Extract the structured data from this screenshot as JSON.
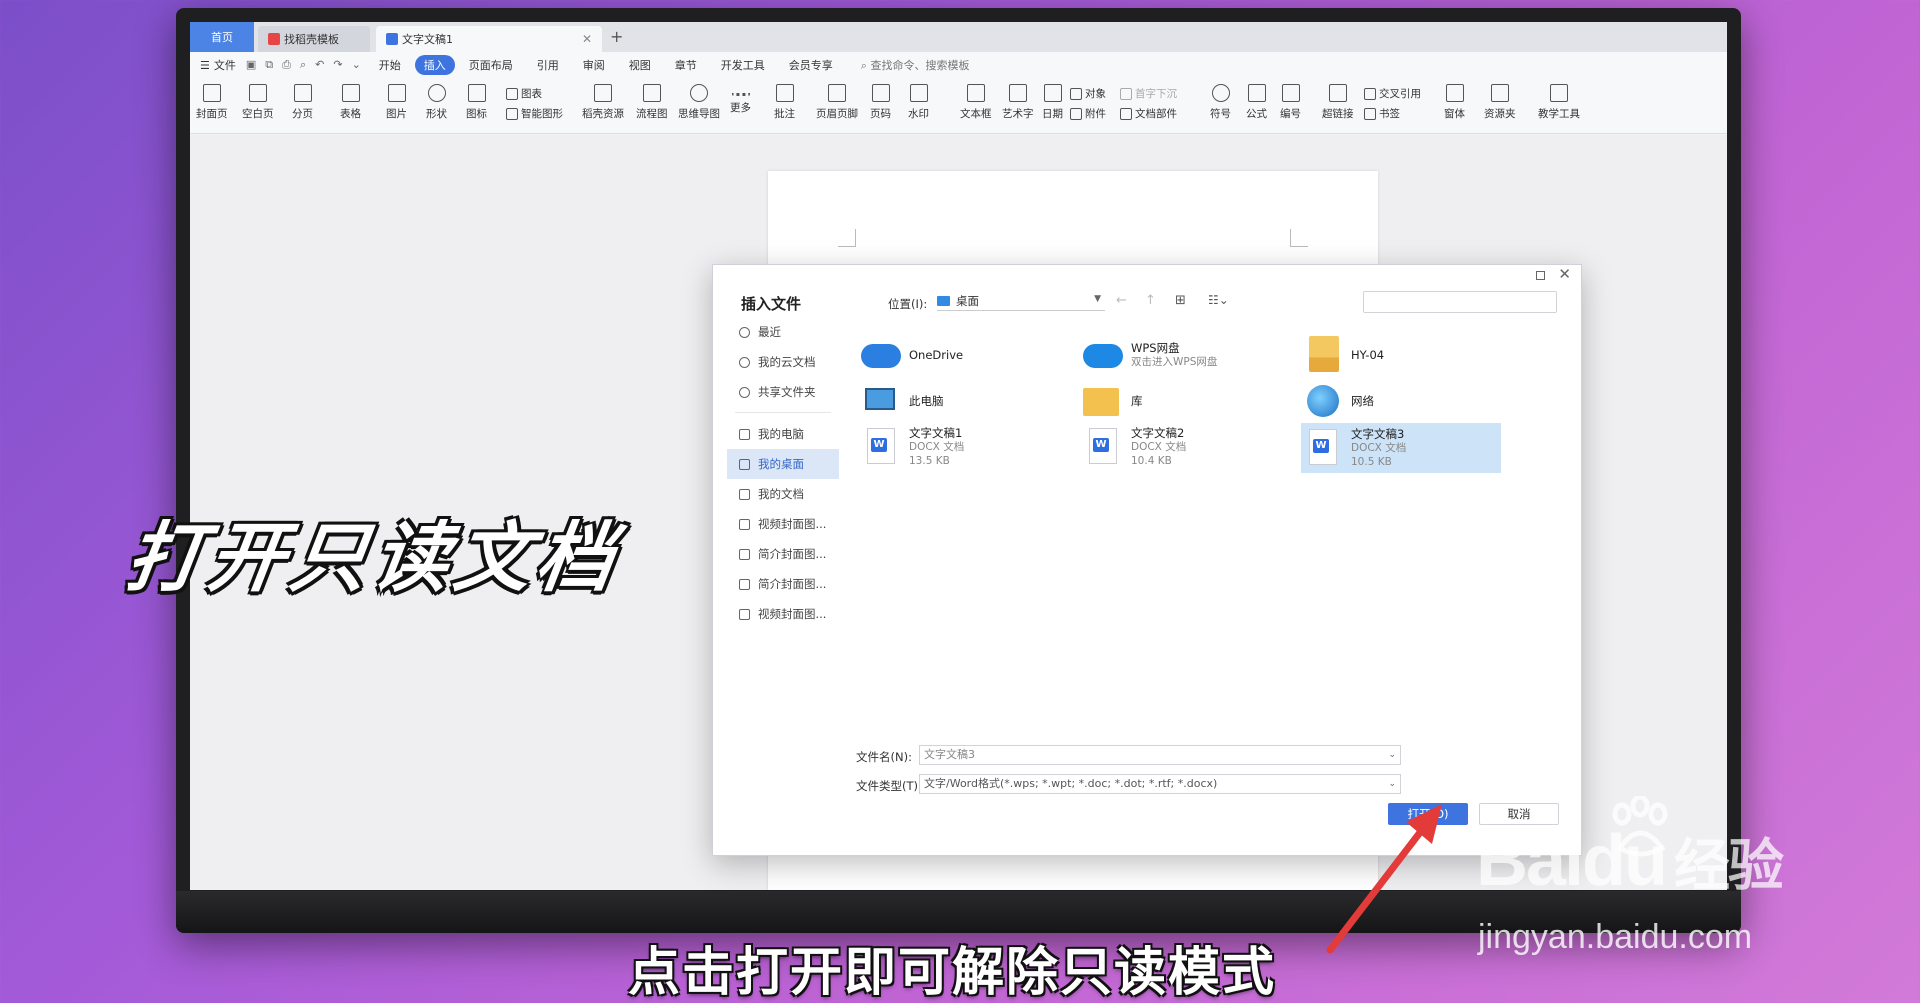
{
  "tabs": {
    "home": "首页",
    "template": "找稻壳模板",
    "doc": "文字文稿1",
    "add": "+"
  },
  "menu": {
    "file": "文件",
    "items": [
      "开始",
      "插入",
      "页面布局",
      "引用",
      "审阅",
      "视图",
      "章节",
      "开发工具",
      "会员专享"
    ],
    "active_index": 1,
    "search": "查找命令、搜索模板"
  },
  "ribbon": {
    "buttons": [
      "封面页",
      "空白页",
      "分页",
      "表格",
      "图片",
      "形状",
      "图标",
      "稻壳资源",
      "流程图",
      "思维导图",
      "更多",
      "批注",
      "页眉页脚",
      "页码",
      "水印",
      "文本框",
      "艺术字",
      "日期",
      "符号",
      "公式",
      "编号",
      "超链接",
      "窗体",
      "资源夹",
      "教学工具"
    ],
    "small": {
      "chart": "图表",
      "smart": "智能图形",
      "object": "对象",
      "dropcap": "首字下沉",
      "attach": "附件",
      "docpart": "文档部件",
      "crossref": "交叉引用",
      "bookmark": "书签"
    }
  },
  "dialog": {
    "title": "插入文件",
    "location_label": "位置(I):",
    "location_value": "桌面",
    "search_placeholder": "",
    "sidebar": {
      "recent": "最近",
      "cloud": "我的云文档",
      "shared": "共享文件夹",
      "computer": "我的电脑",
      "desktop": "我的桌面",
      "docs": "我的文档",
      "f1": "视频封面图...",
      "f2": "简介封面图...",
      "f3": "简介封面图...",
      "f4": "视频封面图..."
    },
    "files": {
      "onedrive": "OneDrive",
      "wps": "WPS网盘",
      "wps_sub": "双击进入WPS网盘",
      "hy": "HY-04",
      "pc": "此电脑",
      "lib": "库",
      "net": "网络",
      "doc1": "文字文稿1",
      "doc1_type": "DOCX 文档",
      "doc1_size": "13.5 KB",
      "doc2": "文字文稿2",
      "doc2_type": "DOCX 文档",
      "doc2_size": "10.4 KB",
      "doc3": "文字文稿3",
      "doc3_type": "DOCX 文档",
      "doc3_size": "10.5 KB"
    },
    "filename_label": "文件名(N):",
    "filename_value": "文字文稿3",
    "filetype_label": "文件类型(T):",
    "filetype_value": "文字/Word格式(*.wps; *.wpt; *.doc; *.dot; *.rtf; *.docx)",
    "open": "打开(O)",
    "cancel": "取消"
  },
  "captions": {
    "title": "打开只读文档",
    "sub": "点击打开即可解除只读模式"
  },
  "watermark": {
    "logo_text": "Bai",
    "logo_text2": "du",
    "logo_cn": "经验",
    "url": "jingyan.baidu.com"
  },
  "colors": {
    "accent": "#3d74e0",
    "selection": "#cce3f8",
    "arrow": "#e33a3a"
  }
}
